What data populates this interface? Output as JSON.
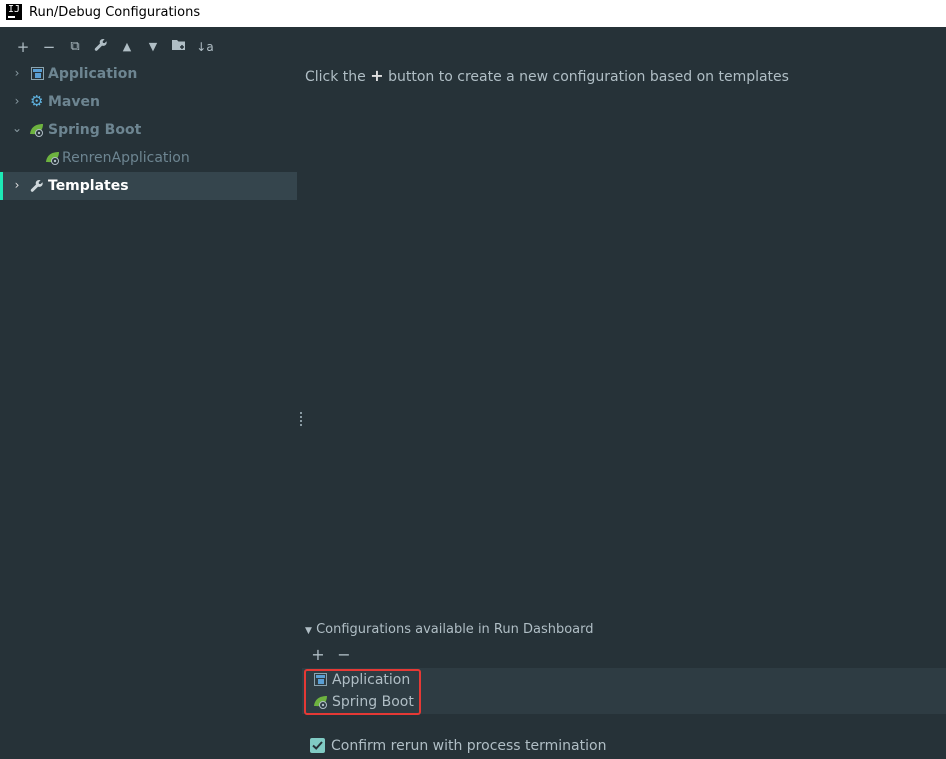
{
  "window": {
    "title": "Run/Debug Configurations",
    "app_icon_text": "IJ"
  },
  "toolbar": {
    "add": "+",
    "remove": "−",
    "copy": "⧉",
    "edit_defaults": "🔧",
    "move_up": "▲",
    "move_down": "▼",
    "folder": "📁",
    "sort": "↓a"
  },
  "tree": {
    "items": [
      {
        "label": "Application",
        "expanded": false,
        "icon": "application-icon"
      },
      {
        "label": "Maven",
        "expanded": false,
        "icon": "maven-gear-icon"
      },
      {
        "label": "Spring Boot",
        "expanded": true,
        "icon": "spring-boot-icon"
      },
      {
        "label": "RenrenApplication",
        "child": true,
        "icon": "spring-boot-icon"
      },
      {
        "label": "Templates",
        "selected": true,
        "icon": "wrench-icon"
      }
    ]
  },
  "main": {
    "hint_before": "Click the",
    "hint_plus": "+",
    "hint_after": "button to create a new configuration based on templates"
  },
  "dashboard": {
    "section_title": "Configurations available in Run Dashboard",
    "add": "+",
    "remove": "−",
    "items": [
      {
        "label": "Application",
        "icon": "application-icon"
      },
      {
        "label": "Spring Boot",
        "icon": "spring-boot-icon"
      }
    ]
  },
  "confirm_rerun": {
    "label": "Confirm rerun with process termination",
    "checked": true
  },
  "colors": {
    "background": "#263238",
    "selection": "#35454d",
    "accent": "#1de9b6",
    "checkbox": "#80cbc4",
    "highlight_border": "#e53935"
  }
}
